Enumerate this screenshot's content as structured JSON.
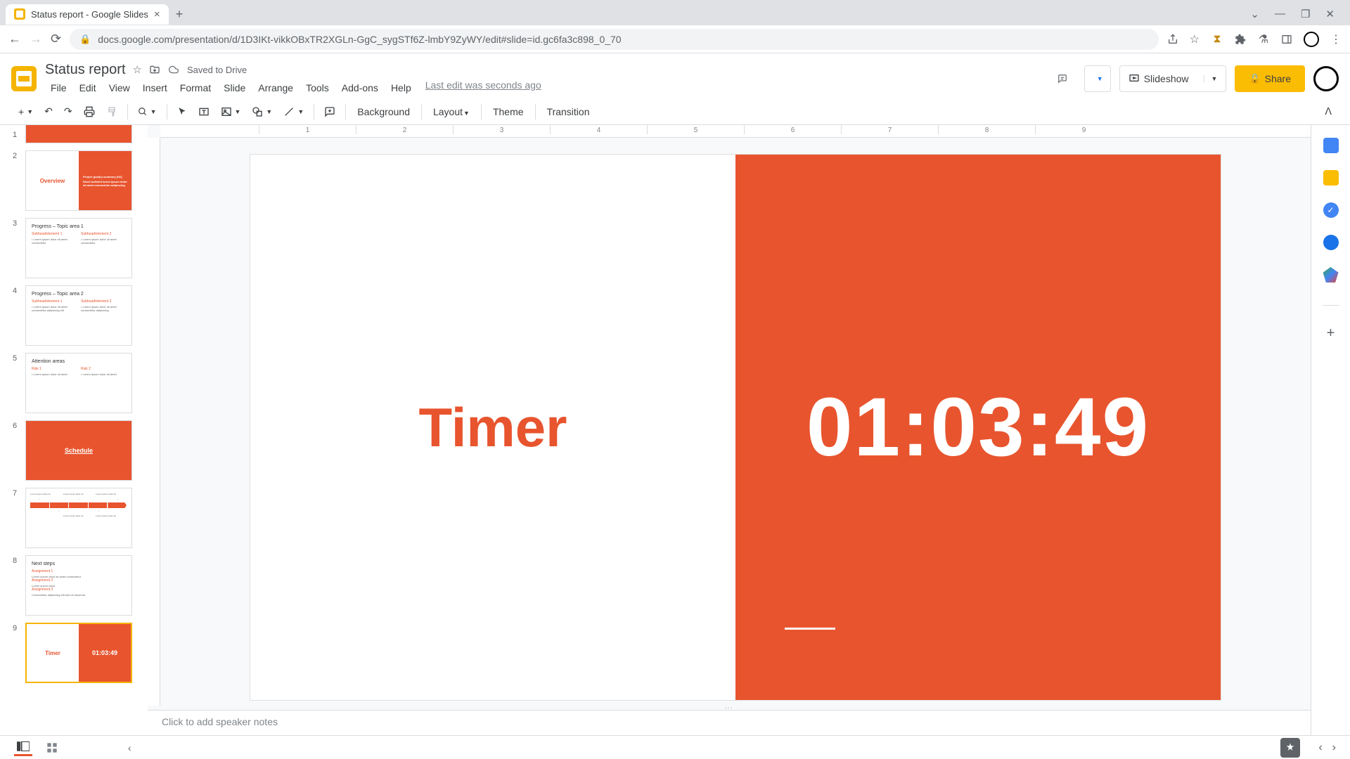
{
  "browser": {
    "tab_title": "Status report - Google Slides",
    "url": "docs.google.com/presentation/d/1D3IKt-vikkOBxTR2XGLn-GgC_sygSTf6Z-lmbY9ZyWY/edit#slide=id.gc6fa3c898_0_70"
  },
  "doc": {
    "title": "Status report",
    "saved": "Saved to Drive",
    "last_edit": "Last edit was seconds ago",
    "menus": [
      "File",
      "Edit",
      "View",
      "Insert",
      "Format",
      "Slide",
      "Arrange",
      "Tools",
      "Add-ons",
      "Help"
    ]
  },
  "header_buttons": {
    "slideshow": "Slideshow",
    "share": "Share"
  },
  "toolbar": {
    "background": "Background",
    "layout": "Layout",
    "theme": "Theme",
    "transition": "Transition"
  },
  "ruler_marks": [
    "1",
    "2",
    "3",
    "4",
    "5",
    "6",
    "7",
    "8",
    "9"
  ],
  "slide": {
    "left_title": "Timer",
    "timer_value": "01:03:49"
  },
  "notes_placeholder": "Click to add speaker notes",
  "thumbs": [
    {
      "num": "1",
      "type": "title-orange"
    },
    {
      "num": "2",
      "type": "overview",
      "label": "Overview"
    },
    {
      "num": "3",
      "type": "content",
      "title": "Progress – Topic area 1"
    },
    {
      "num": "4",
      "type": "content",
      "title": "Progress – Topic area 2"
    },
    {
      "num": "5",
      "type": "content",
      "title": "Attention areas"
    },
    {
      "num": "6",
      "type": "section-orange",
      "label": "Schedule"
    },
    {
      "num": "7",
      "type": "timeline"
    },
    {
      "num": "8",
      "type": "content",
      "title": "Next steps"
    },
    {
      "num": "9",
      "type": "timer",
      "label_l": "Timer",
      "label_r": "01:03:49"
    }
  ]
}
